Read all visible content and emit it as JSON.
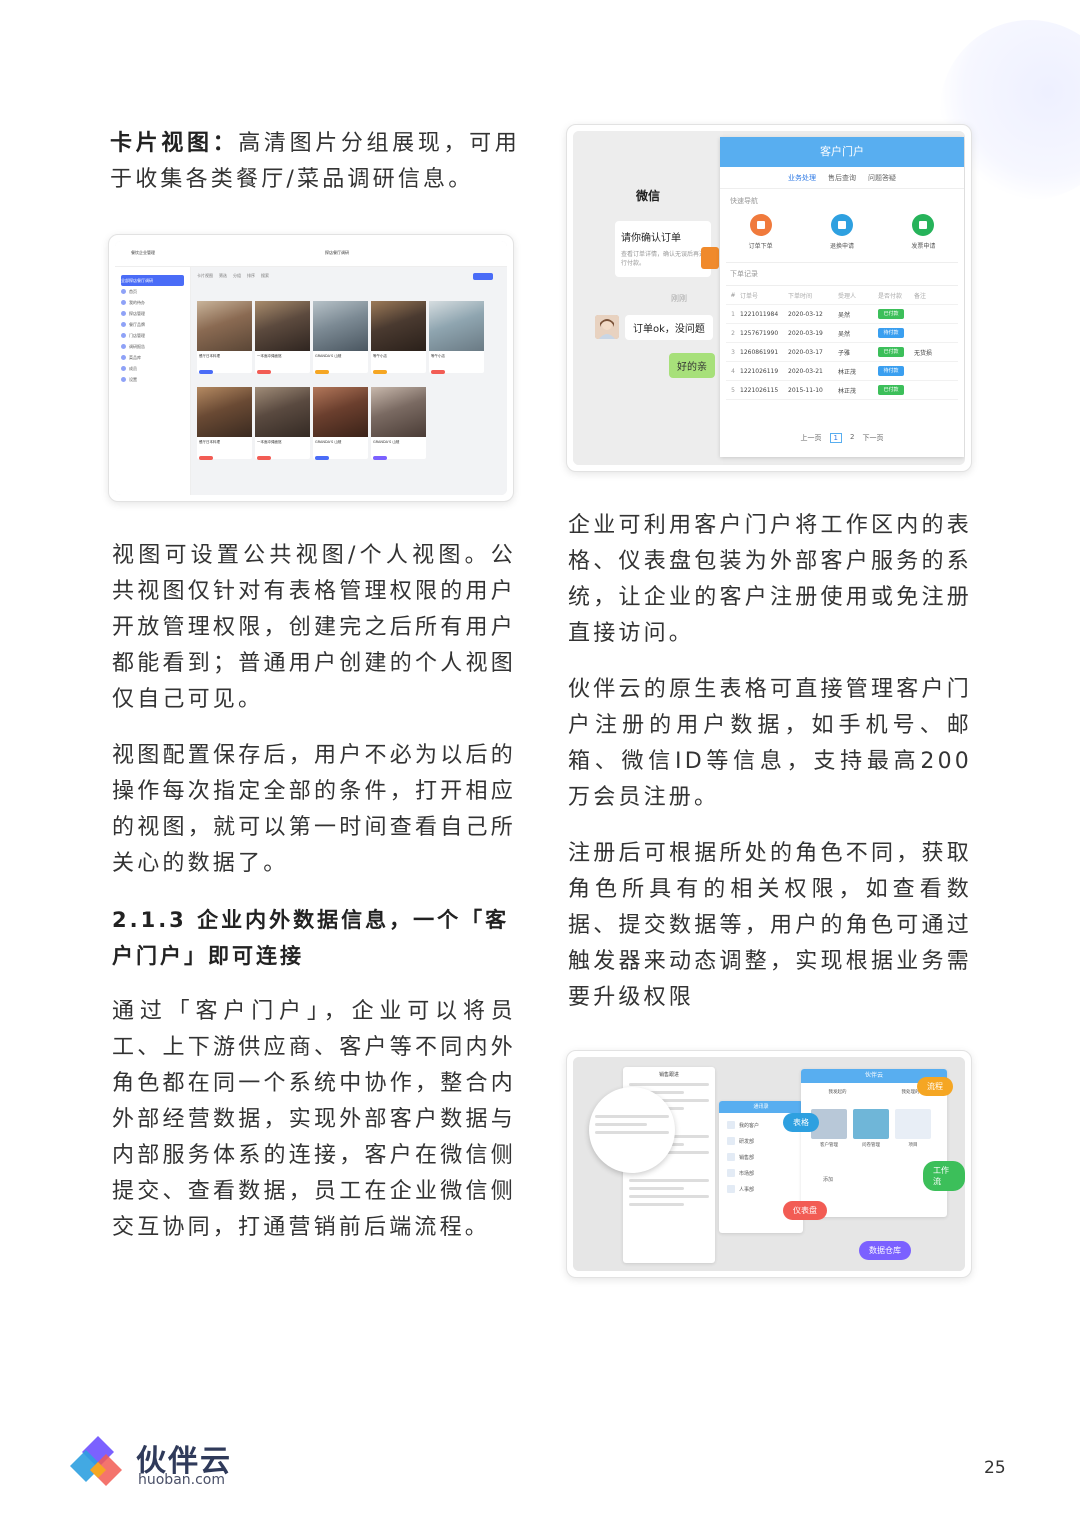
{
  "left": {
    "p1_bold": "卡片视图：",
    "p1_rest": "高清图片分组展现，可用于收集各类餐厅/菜品调研信息。",
    "p2": "视图可设置公共视图/个人视图。公共视图仅针对有表格管理权限的用户开放管理权限，创建完之后所有用户都能看到；普通用户创建的个人视图仅自己可见。",
    "p3": "视图配置保存后，用户不必为以后的操作每次指定全部的条件，打开相应的视图，就可以第一时间查看自己所关心的数据了。",
    "heading": "2.1.3 企业内外数据信息，一个「客户门户」即可连接",
    "p4": "通过「客户门户」，企业可以将员工、上下游供应商、客户等不同内外角色都在同一个系统中协作，整合内外部经营数据，实现外部客户数据与内部服务体系的连接，客户在微信侧提交、查看数据，员工在企业微信侧交互协同，打通营销前后端流程。"
  },
  "right": {
    "p1": "企业可利用客户门户将工作区内的表格、仪表盘包装为外部客户服务的系统，让企业的客户注册使用或免注册直接访问。",
    "p2": "伙伴云的原生表格可直接管理客户门户注册的用户数据，如手机号、邮箱、微信ID等信息，支持最高200万会员注册。",
    "p3": "注册后可根据所处的角色不同，获取角色所具有的相关权限，如查看数据、提交数据等，用户的角色可通过触发器来动态调整，实现根据业务需要升级权限"
  },
  "card_view": {
    "app_name": "餐饮企业管理",
    "table_title": "探店餐厅调研",
    "sidebar": [
      "全部探店餐厅调研",
      "首页",
      "我的待办",
      "探店管理",
      "餐厅品牌",
      "门店管理",
      "调研报告",
      "菜品库",
      "成员",
      "设置"
    ],
    "toolbar": [
      "卡片视图",
      "筛选",
      "分组",
      "排序",
      "搜索"
    ],
    "cards": [
      {
        "name": "餐厅日本料理",
        "tag_color": "#4a6cf7"
      },
      {
        "name": "一本面冲绳面馆",
        "tag_color": "#f25c54"
      },
      {
        "name": "GRANDA'S 山楂",
        "tag_color": "#f5a623"
      },
      {
        "name": "等午小店",
        "tag_color": "#f5a623"
      },
      {
        "name": "等午小店",
        "tag_color": "#f25c54"
      },
      {
        "name": "餐厅日本料理",
        "tag_color": "#f25c54"
      },
      {
        "name": "一本面冲绳面馆",
        "tag_color": "#f25c54"
      },
      {
        "name": "GRANDA'S 山楂",
        "tag_color": "#4a6cf7"
      },
      {
        "name": "GRANDA'S 山楂",
        "tag_color": "#7b61ff"
      }
    ]
  },
  "portal": {
    "wechat_title": "微信",
    "confirm_title": "请你确认订单",
    "confirm_sub": "查看订单详情，确认无误后再进行付款。",
    "time": "刚刚",
    "msg1": "订单ok，没问题",
    "msg2": "好的亲",
    "header": "客户门户",
    "tabs": [
      "业务处理",
      "售后查询",
      "问题答疑"
    ],
    "quick_nav": "快速导航",
    "quick_items": [
      {
        "label": "订单下单",
        "color": "#f07a3c"
      },
      {
        "label": "退换申请",
        "color": "#2ea0e0"
      },
      {
        "label": "发票申请",
        "color": "#26b35a"
      }
    ],
    "records": "下单记录",
    "columns": [
      "#",
      "订单号",
      "下单时间",
      "受理人",
      "是否付款",
      "备注"
    ],
    "rows": [
      {
        "n": "1",
        "id": "1221011984",
        "date": "2020-03-12",
        "who": "吴然",
        "status": "已付款",
        "color": "#3cbf5a",
        "note": ""
      },
      {
        "n": "2",
        "id": "1257671990",
        "date": "2020-03-19",
        "who": "吴然",
        "status": "待付款",
        "color": "#3a9ff0",
        "note": ""
      },
      {
        "n": "3",
        "id": "1260861991",
        "date": "2020-03-17",
        "who": "子雅",
        "status": "已付款",
        "color": "#3cbf5a",
        "note": "无货损"
      },
      {
        "n": "4",
        "id": "1221026119",
        "date": "2020-03-21",
        "who": "林正茂",
        "status": "待付款",
        "color": "#3a9ff0",
        "note": ""
      },
      {
        "n": "5",
        "id": "1221026115",
        "date": "2015-11-10",
        "who": "林正茂",
        "status": "已付款",
        "color": "#3cbf5a",
        "note": ""
      }
    ],
    "prev": "上一页",
    "page1": "1",
    "page2": "2",
    "next": "下一页"
  },
  "diagram": {
    "left_panel_title": "销售跟进",
    "brand_panel_title": "伙伴云",
    "contacts_title": "通讯录",
    "contacts": [
      "我的客户",
      "研发部",
      "销售部",
      "市场部",
      "人事部"
    ],
    "cells": [
      "客户管理",
      "问卷管理",
      "项目"
    ],
    "pills": [
      {
        "label": "流程",
        "color": "#f5a623"
      },
      {
        "label": "表格",
        "color": "#2ea0e0"
      },
      {
        "label": "工作流",
        "color": "#3cbf5a"
      },
      {
        "label": "仪表盘",
        "color": "#f25c54"
      },
      {
        "label": "数据仓库",
        "color": "#7b61ff"
      }
    ],
    "add": "添加",
    "mine": "我发起的",
    "handled": "我处理的"
  },
  "footer": {
    "brand": "伙伴云",
    "domain": "huoban.com",
    "page": "25"
  }
}
